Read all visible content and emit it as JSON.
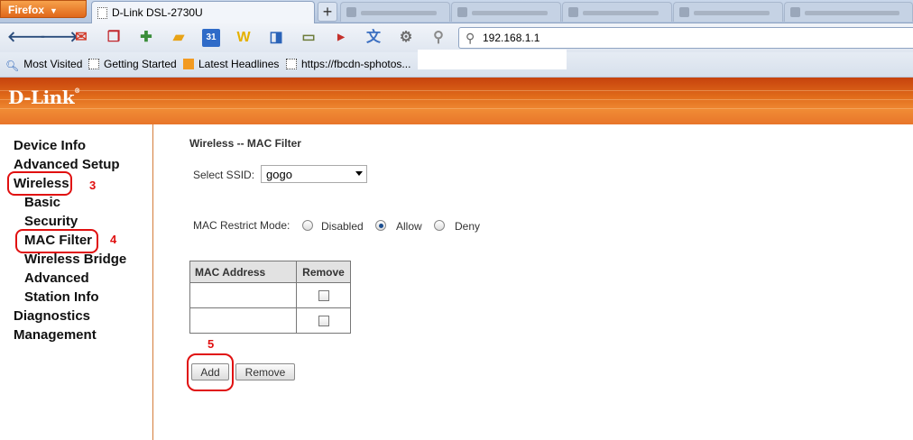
{
  "browser": {
    "app_button": "Firefox",
    "active_tab": "D-Link DSL-2730U",
    "new_tab": "+",
    "url": "192.168.1.1",
    "bookmarks": [
      "Most Visited",
      "Getting Started",
      "Latest Headlines",
      "https://fbcdn-sphotos..."
    ]
  },
  "router": {
    "brand": "D-Link",
    "brand_mark": "®"
  },
  "sidebar": {
    "items": [
      {
        "label": "Device Info"
      },
      {
        "label": "Advanced Setup"
      },
      {
        "label": "Wireless"
      },
      {
        "label": "Basic"
      },
      {
        "label": "Security"
      },
      {
        "label": "MAC Filter"
      },
      {
        "label": "Wireless Bridge"
      },
      {
        "label": "Advanced"
      },
      {
        "label": "Station Info"
      },
      {
        "label": "Diagnostics"
      },
      {
        "label": "Management"
      }
    ]
  },
  "annotations": {
    "step3": "3",
    "step4": "4",
    "step5": "5",
    "color": "#e01010"
  },
  "main": {
    "title": "Wireless -- MAC Filter",
    "ssid_label": "Select SSID:",
    "ssid_value": "gogo",
    "restrict_label": "MAC Restrict Mode:",
    "restrict_options": [
      {
        "label": "Disabled",
        "checked": false
      },
      {
        "label": "Allow",
        "checked": true
      },
      {
        "label": "Deny",
        "checked": false
      }
    ],
    "table": {
      "headers": [
        "MAC Address",
        "Remove"
      ],
      "rows": [
        {
          "mac": "",
          "remove": false
        },
        {
          "mac": "",
          "remove": false
        }
      ]
    },
    "add_button": "Add",
    "remove_button": "Remove"
  },
  "colors": {
    "header_orange": "#e06a1a",
    "firefox_orange": "#e0671a"
  }
}
